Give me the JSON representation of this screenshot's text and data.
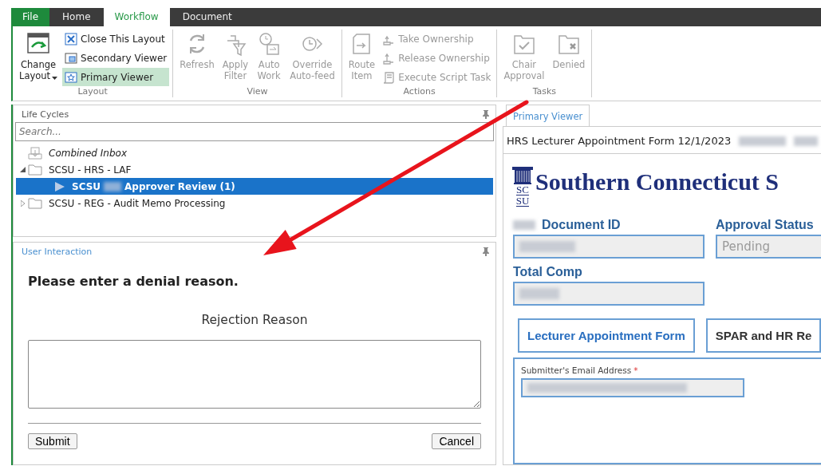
{
  "menu_tabs": [
    {
      "label": "File",
      "kind": "file",
      "selected": false
    },
    {
      "label": "Home",
      "kind": "tab",
      "selected": false
    },
    {
      "label": "Workflow",
      "kind": "tab",
      "selected": true
    },
    {
      "label": "Document",
      "kind": "tab",
      "selected": false
    }
  ],
  "ribbon": [
    {
      "label": "Layout",
      "items": [
        {
          "kind": "large",
          "label": "Change\nLayout",
          "dropdown": true,
          "disabled": false
        },
        {
          "kind": "small",
          "label": "Close This Layout",
          "disabled": false,
          "selected": false
        },
        {
          "kind": "small",
          "label": "Secondary Viewer",
          "disabled": false,
          "selected": false
        },
        {
          "kind": "small",
          "label": "Primary Viewer",
          "disabled": false,
          "selected": true
        }
      ]
    },
    {
      "label": "View",
      "items": [
        {
          "kind": "large",
          "label": "Refresh",
          "disabled": true
        },
        {
          "kind": "large",
          "label": "Apply\nFilter",
          "disabled": true
        },
        {
          "kind": "large",
          "label": "Auto\nWork",
          "disabled": true
        },
        {
          "kind": "large",
          "label": "Override\nAuto-feed",
          "disabled": true
        }
      ]
    },
    {
      "label": "Actions",
      "items": [
        {
          "kind": "large",
          "label": "Route\nItem",
          "disabled": true
        },
        {
          "kind": "small",
          "label": "Take Ownership",
          "disabled": true,
          "selected": false
        },
        {
          "kind": "small",
          "label": "Release Ownership",
          "disabled": true,
          "selected": false
        },
        {
          "kind": "small",
          "label": "Execute Script Task",
          "disabled": true,
          "selected": false
        }
      ]
    },
    {
      "label": "Tasks",
      "items": [
        {
          "kind": "large",
          "label": "Chair\nApproval",
          "disabled": true
        },
        {
          "kind": "large",
          "label": "Denied",
          "disabled": true
        }
      ]
    }
  ],
  "life_cycles": {
    "title": "Life Cycles",
    "search": {
      "placeholder": "Search..."
    },
    "tree": [
      {
        "kind": "inbox",
        "label_parts": [
          "Combined Inbox"
        ],
        "selected": false
      },
      {
        "kind": "folder",
        "label_parts": [
          "SCSU - HRS - LAF"
        ],
        "expanded": true,
        "selected": false,
        "children": [
          {
            "kind": "queue",
            "label_parts": [
              "SCSU",
              "Approver Review (1)"
            ],
            "redacted": true,
            "selected": true
          }
        ]
      },
      {
        "kind": "folder",
        "label_parts": [
          "SCSU - REG - Audit Memo Processing"
        ],
        "expanded": false,
        "selected": false
      }
    ]
  },
  "user_interaction": {
    "title": "User Interaction",
    "prompt": "Please enter a denial reason.",
    "field_label": "Rejection Reason",
    "buttons": [
      "Submit",
      "Cancel"
    ]
  },
  "viewer": {
    "tabs": [
      {
        "label": "Primary Viewer",
        "selected": true
      }
    ],
    "document_title": "HRS Lecturer Appointment Form 12/1/2023",
    "logo_text": [
      "SC",
      "SU"
    ],
    "university_name": "Southern Connecticut S",
    "fields": [
      {
        "label": "Document ID",
        "redacted": true
      },
      {
        "label": "Approval Status",
        "value": "Pending",
        "redacted": false
      },
      {
        "label": "Total Comp",
        "redacted": true
      }
    ],
    "form_tabs": [
      {
        "label": "Lecturer Appointment Form",
        "selected": true
      },
      {
        "label": "SPAR and HR Re",
        "selected": false
      }
    ],
    "section_fields": [
      {
        "label": "Submitter's Email Address",
        "required_mark": "*",
        "redacted": true
      }
    ]
  }
}
